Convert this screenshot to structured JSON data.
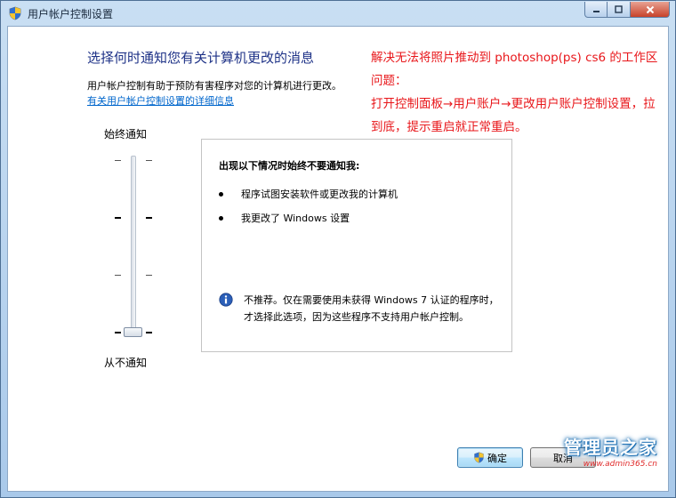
{
  "window": {
    "title": "用户帐户控制设置"
  },
  "main": {
    "heading": "选择何时通知您有关计算机更改的消息",
    "description": "用户帐户控制有助于预防有害程序对您的计算机进行更改。",
    "link": "有关用户帐户控制设置的详细信息"
  },
  "note": {
    "lines": [
      "解决无法将照片推动到 photoshop(ps) cs6 的工作区问题：",
      "打开控制面板→用户账户→更改用户账户控制设置，拉到底，提示重启就正常重启。"
    ],
    "color": "#e8161a"
  },
  "slider": {
    "top_label": "始终通知",
    "bottom_label": "从不通知",
    "level": 0,
    "levels": 4
  },
  "info": {
    "title": "出现以下情况时始终不要通知我:",
    "bullets": [
      "程序试图安装软件或更改我的计算机",
      "我更改了 Windows 设置"
    ],
    "note": "不推荐。仅在需要使用未获得 Windows 7 认证的程序时，才选择此选项，因为这些程序不支持用户帐户控制。"
  },
  "buttons": {
    "ok": "确定",
    "cancel": "取消"
  },
  "watermark": {
    "text": "管理员之家",
    "url": "www.admin365.cn"
  },
  "icons": {
    "title": "uac-shield-icon",
    "info": "info-icon",
    "ok": "uac-shield-icon"
  }
}
